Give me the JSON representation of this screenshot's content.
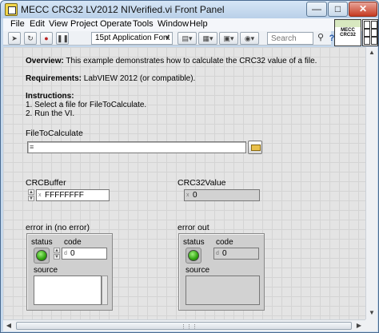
{
  "window": {
    "title": "MECC CRC32 LV2012 NIVerified.vi Front Panel",
    "min_icon": "minimize-icon",
    "max_icon": "maximize-icon",
    "close_icon": "close-icon"
  },
  "menu": [
    "File",
    "Edit",
    "View",
    "Project",
    "Operate",
    "Tools",
    "Window",
    "Help"
  ],
  "toolbar": {
    "run_icon": "run-arrow-icon",
    "run_continuous_icon": "run-continuously-icon",
    "abort_icon": "abort-icon",
    "pause_icon": "pause-icon",
    "font_label": "15pt Application Font",
    "search_placeholder": "Search"
  },
  "vi_icon": {
    "band_text": "MECC",
    "label": "CRC32"
  },
  "panel": {
    "overview_label": "Overview:",
    "overview_text": " This example demonstrates how to calculate the CRC32 value of a file.",
    "requirements_label": "Requirements:",
    "requirements_text": " LabVIEW 2012 (or compatible).",
    "instructions_label": "Instructions:",
    "instruction_1": "1. Select a file for FileToCalculate.",
    "instruction_2": "2. Run the VI.",
    "file_label": "FileToCalculate",
    "file_value": "",
    "crcbuffer_label": "CRCBuffer",
    "crcbuffer_radix": "x",
    "crcbuffer_value": "FFFFFFFF",
    "crc32value_label": "CRC32Value",
    "crc32value_radix": "x",
    "crc32value_value": "0",
    "error_in_label": "error in (no error)",
    "error_out_label": "error out",
    "status_label": "status",
    "code_label": "code",
    "source_label": "source",
    "code_radix": "d",
    "error_in_code": "0",
    "error_out_code": "0"
  }
}
